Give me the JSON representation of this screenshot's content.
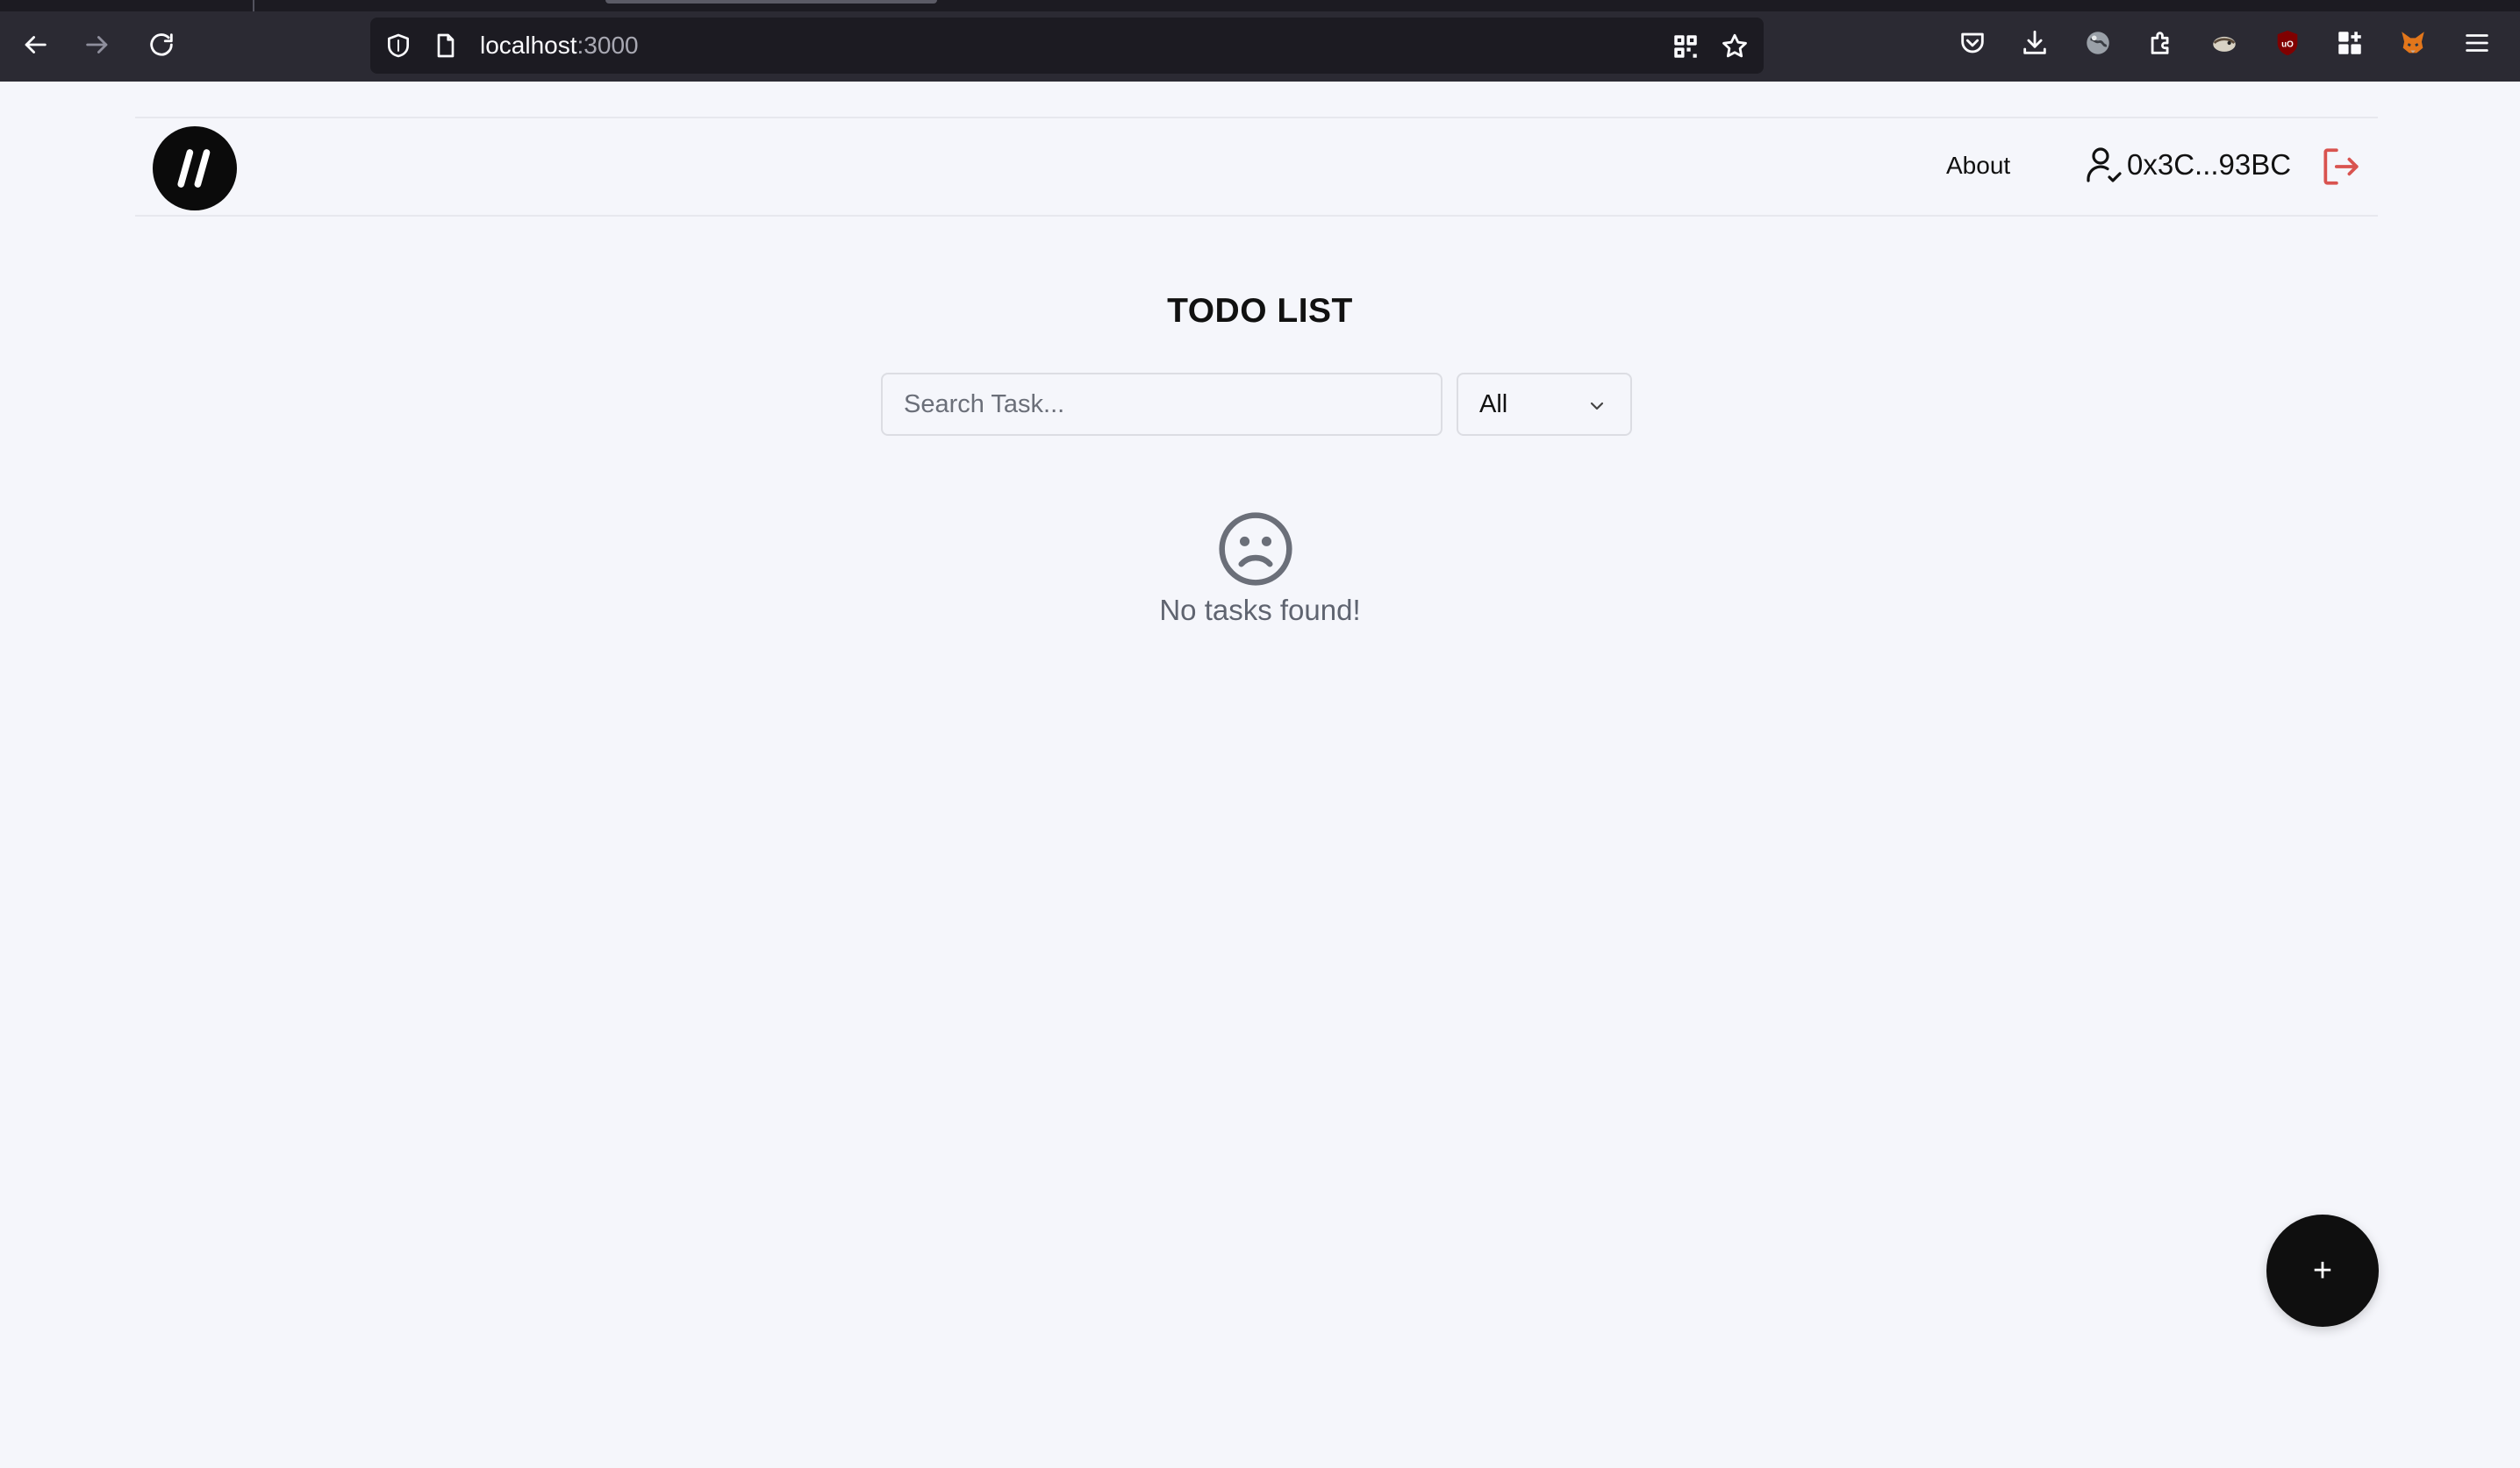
{
  "browser": {
    "url_host": "localhost",
    "url_port": ":3000",
    "icons": [
      "back-icon",
      "forward-icon",
      "reload-icon",
      "shield-icon",
      "page-icon",
      "qr-code-icon",
      "bookmark-star-icon",
      "pocket-icon",
      "download-icon",
      "extension-globe-icon",
      "extensions-puzzle-icon",
      "extension-bird-icon",
      "ublock-icon",
      "extension-grid-icon",
      "metamask-fox-icon",
      "menu-icon"
    ]
  },
  "header": {
    "logo_icon": "double-slash-logo",
    "nav_about": "About",
    "user_address": "0x3C...93BC",
    "logout_icon": "logout-icon"
  },
  "main": {
    "title": "TODO LIST",
    "search_placeholder": "Search Task...",
    "filter_selected": "All",
    "empty_icon": "sad-face-icon",
    "empty_message": "No tasks found!",
    "fab_label": "+"
  },
  "colors": {
    "page_bg": "#f5f6fb",
    "chrome_bg": "#2b2a33",
    "logout_red": "#d9534f",
    "fab_bg": "#0f0f0f"
  }
}
